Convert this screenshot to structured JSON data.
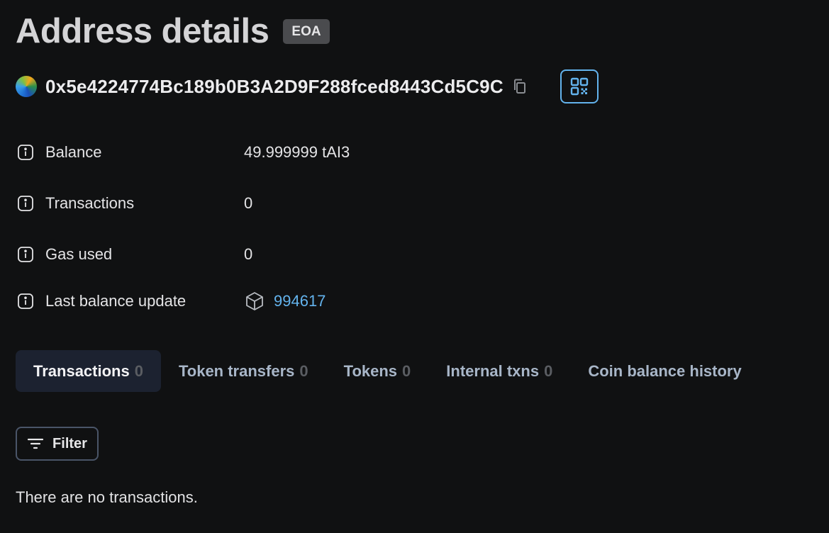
{
  "header": {
    "title": "Address details",
    "badge": "EOA"
  },
  "address": {
    "hash": "0x5e4224774Bc189b0B3A2D9F288fced8443Cd5C9C",
    "copy_icon": "copy-icon",
    "qr_icon": "qr-code-icon"
  },
  "details": {
    "balance": {
      "label": "Balance",
      "value": "49.999999 tAI3"
    },
    "transactions": {
      "label": "Transactions",
      "value": "0"
    },
    "gas_used": {
      "label": "Gas used",
      "value": "0"
    },
    "last_balance_update": {
      "label": "Last balance update",
      "value": "994617",
      "icon": "block-icon"
    }
  },
  "tabs": [
    {
      "label": "Transactions",
      "count": "0",
      "active": true
    },
    {
      "label": "Token transfers",
      "count": "0"
    },
    {
      "label": "Tokens",
      "count": "0"
    },
    {
      "label": "Internal txns",
      "count": "0"
    },
    {
      "label": "Coin balance history"
    }
  ],
  "filter": {
    "label": "Filter",
    "icon": "filter-icon"
  },
  "empty_state": "There are no transactions.",
  "colors": {
    "background": "#101112",
    "accent": "#63b3ed",
    "active_tab": "#1c2230",
    "badge": "#4a4b4e"
  }
}
